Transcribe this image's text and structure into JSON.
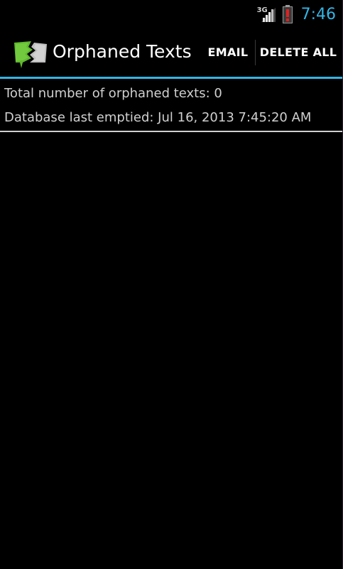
{
  "status_bar": {
    "network_type": "3G",
    "time": "7:46",
    "battery_alert_icon": "battery-alert-icon",
    "signal_icon": "signal-icon"
  },
  "action_bar": {
    "title": "Orphaned Texts",
    "app_icon": "torn-speech-bubble-icon",
    "actions": {
      "email": "EMAIL",
      "delete_all": "DELETE ALL"
    }
  },
  "content": {
    "total_line": "Total number of orphaned texts: 0",
    "emptied_line": "Database last emptied: Jul 16, 2013 7:45:20 AM"
  },
  "colors": {
    "accent": "#33b5e5",
    "background": "#000000",
    "app_icon_green": "#5fb92d"
  }
}
